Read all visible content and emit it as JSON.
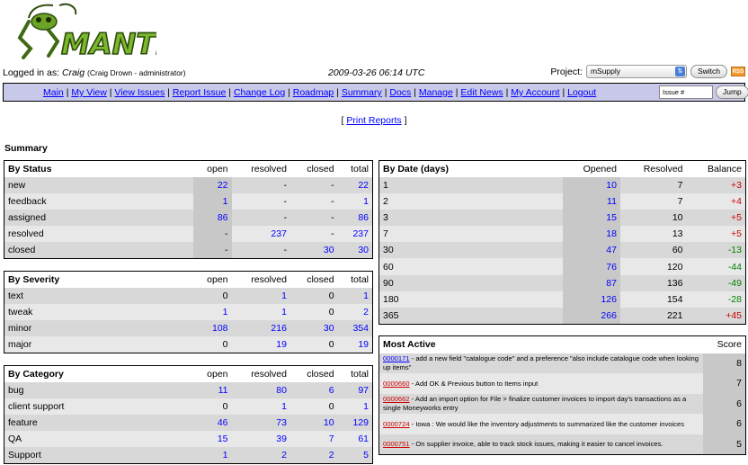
{
  "logo": {
    "text": "MANTIS"
  },
  "login": {
    "prefix": "Logged in as:",
    "user": "Craig",
    "details": "(Craig Drown - administrator)",
    "datetime": "2009-03-26 06:14 UTC"
  },
  "project": {
    "label": "Project:",
    "selected": "mSupply",
    "switch_label": "Switch",
    "rss_label": "RSS"
  },
  "menu": {
    "items": [
      "Main",
      "My View",
      "View Issues",
      "Report Issue",
      "Change Log",
      "Roadmap",
      "Summary",
      "Docs",
      "Manage",
      "Edit News",
      "My Account",
      "Logout"
    ],
    "separator": "|",
    "issue_placeholder": "Issue #",
    "jump_label": "Jump"
  },
  "print_reports": {
    "open": "[",
    "label": "Print Reports",
    "close": "]"
  },
  "summary_title": "Summary",
  "by_status": {
    "title": "By Status",
    "columns": [
      "open",
      "resolved",
      "closed",
      "total"
    ],
    "rows": [
      {
        "label": "new",
        "open": "22",
        "resolved": "-",
        "closed": "-",
        "total": "22"
      },
      {
        "label": "feedback",
        "open": "1",
        "resolved": "-",
        "closed": "-",
        "total": "1"
      },
      {
        "label": "assigned",
        "open": "86",
        "resolved": "-",
        "closed": "-",
        "total": "86"
      },
      {
        "label": "resolved",
        "open": "-",
        "resolved": "237",
        "closed": "-",
        "total": "237"
      },
      {
        "label": "closed",
        "open": "-",
        "resolved": "-",
        "closed": "30",
        "total": "30"
      }
    ]
  },
  "by_severity": {
    "title": "By Severity",
    "columns": [
      "open",
      "resolved",
      "closed",
      "total"
    ],
    "rows": [
      {
        "label": "text",
        "open": "0",
        "resolved": "1",
        "closed": "0",
        "total": "1"
      },
      {
        "label": "tweak",
        "open": "1",
        "resolved": "1",
        "closed": "0",
        "total": "2"
      },
      {
        "label": "minor",
        "open": "108",
        "resolved": "216",
        "closed": "30",
        "total": "354"
      },
      {
        "label": "major",
        "open": "0",
        "resolved": "19",
        "closed": "0",
        "total": "19"
      }
    ]
  },
  "by_category": {
    "title": "By Category",
    "columns": [
      "open",
      "resolved",
      "closed",
      "total"
    ],
    "rows": [
      {
        "label": "bug",
        "open": "11",
        "resolved": "80",
        "closed": "6",
        "total": "97"
      },
      {
        "label": "client support",
        "open": "0",
        "resolved": "1",
        "closed": "0",
        "total": "1"
      },
      {
        "label": "feature",
        "open": "46",
        "resolved": "73",
        "closed": "10",
        "total": "129"
      },
      {
        "label": "QA",
        "open": "15",
        "resolved": "39",
        "closed": "7",
        "total": "61"
      },
      {
        "label": "Support",
        "open": "1",
        "resolved": "2",
        "closed": "2",
        "total": "5"
      }
    ]
  },
  "by_date": {
    "title": "By Date (days)",
    "columns": [
      "Opened",
      "Resolved",
      "Balance"
    ],
    "rows": [
      {
        "label": "1",
        "opened": "10",
        "resolved": "7",
        "balance": "+3"
      },
      {
        "label": "2",
        "opened": "11",
        "resolved": "7",
        "balance": "+4"
      },
      {
        "label": "3",
        "opened": "15",
        "resolved": "10",
        "balance": "+5"
      },
      {
        "label": "7",
        "opened": "18",
        "resolved": "13",
        "balance": "+5"
      },
      {
        "label": "30",
        "opened": "47",
        "resolved": "60",
        "balance": "-13"
      },
      {
        "label": "60",
        "opened": "76",
        "resolved": "120",
        "balance": "-44"
      },
      {
        "label": "90",
        "opened": "87",
        "resolved": "136",
        "balance": "-49"
      },
      {
        "label": "180",
        "opened": "126",
        "resolved": "154",
        "balance": "-28"
      },
      {
        "label": "365",
        "opened": "266",
        "resolved": "221",
        "balance": "+45"
      }
    ]
  },
  "most_active": {
    "title": "Most Active",
    "score_label": "Score",
    "rows": [
      {
        "id": "0000171",
        "text": " - add a new field \"catalogue code\" and a preference \"also include catalogue code when looking up items\"",
        "score": "8"
      },
      {
        "id": "0000660",
        "text": " - Add OK & Previous button to Items input",
        "score": "7"
      },
      {
        "id": "0000662",
        "text": " - Add an import option for File > finalize customer invoices to import day's transactions as a single Moneyworks entry",
        "score": "6"
      },
      {
        "id": "0000724",
        "text": " - Iowa : We would like the inventory adjustments to summarized like the customer invoices",
        "score": "6"
      },
      {
        "id": "0000751",
        "text": " - On supplier invoice, able to track stock issues, making it easier to cancel invoices.",
        "score": "5"
      }
    ]
  },
  "colors": {
    "menu_bg": "#c8c8e8",
    "link": "#0000ff",
    "positive_balance": "#cc0000",
    "negative_balance": "#008000",
    "row_dark": "#d8d8d8",
    "row_light": "#e8e8e8"
  }
}
